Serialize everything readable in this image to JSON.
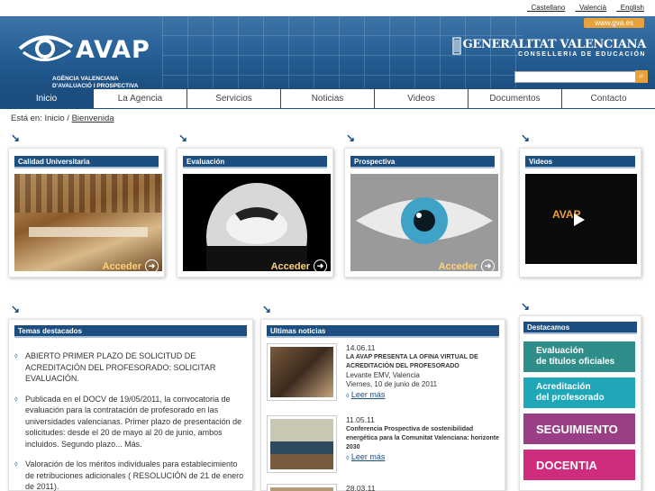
{
  "lang": [
    "_Castellano",
    "_Valencià",
    "_English"
  ],
  "header": {
    "logo_word": "AVAP",
    "logo_sub": "AGÈNCIA VALENCIANA\nD'AVALUACIÓ I PROSPECTIVA",
    "gva_link": "www.gva.es",
    "gen_title": "GENERALITAT VALENCIANA",
    "gen_sub": "CONSELLERIA DE EDUCACIÓN"
  },
  "nav": [
    "Inicio",
    "La Agencia",
    "Servicios",
    "Noticias",
    "Videos",
    "Documentos",
    "Contacto"
  ],
  "breadcrumb": {
    "prefix": "Está en: Inicio / ",
    "current": "Bienvenida"
  },
  "features": [
    {
      "title": "Calidad Universitaria",
      "action": "Acceder"
    },
    {
      "title": "Evaluación",
      "action": "Acceder"
    },
    {
      "title": "Prospectiva",
      "action": "Acceder"
    },
    {
      "title": "Videos",
      "video_brand": "AVAP"
    }
  ],
  "temas": {
    "title": "Temas destacados",
    "items": [
      "ABIERTO PRIMER PLAZO DE SOLICITUD DE ACREDITACIÓN DEL PROFESORADO: SOLICITAR EVALUACIÓN.",
      "Publicada en el DOCV de 19/05/2011, la convocatoria de evaluación para la contratación de profesorado en las universidades valencianas. Primer plazo de presentación de solicitudes: desde el 20 de mayo al 20 de junio, ambos incluidos. Segundo plazo... Más.",
      "Valoración de los méritos individuales para establecimiento de retribuciones adicionales ( RESOLUCIÓN de 21 de enero de 2011)."
    ]
  },
  "news": {
    "title": "Ultimas noticias",
    "items": [
      {
        "date": "14.06.11",
        "headline": "LA AVAP PRESENTA LA OFINA VIRTUAL DE ACREDITACIÓN DEL PROFESORADO",
        "source": "Levante EMV, Valencia",
        "source_date": "Viernes, 10 de junio de 2011",
        "more": "Leer más"
      },
      {
        "date": "11.05.11",
        "headline": "Conferencia Prospectiva de sostenibilidad energética para la Comunitat Valenciana: horizonte 2030",
        "more": "Leer más"
      },
      {
        "date": "28.03.11"
      }
    ]
  },
  "destacamos": {
    "title": "Destacamos",
    "items": [
      {
        "label": "Evaluación\nde títulos oficiales",
        "color": "#2f8e8a"
      },
      {
        "label": "Acreditación\ndel profesorado",
        "color": "#1fa7b7"
      },
      {
        "label": "SEGUIMIENTO",
        "color": "#9a3f86"
      },
      {
        "label": "DOCENTIA",
        "color": "#d02c7d"
      }
    ]
  }
}
